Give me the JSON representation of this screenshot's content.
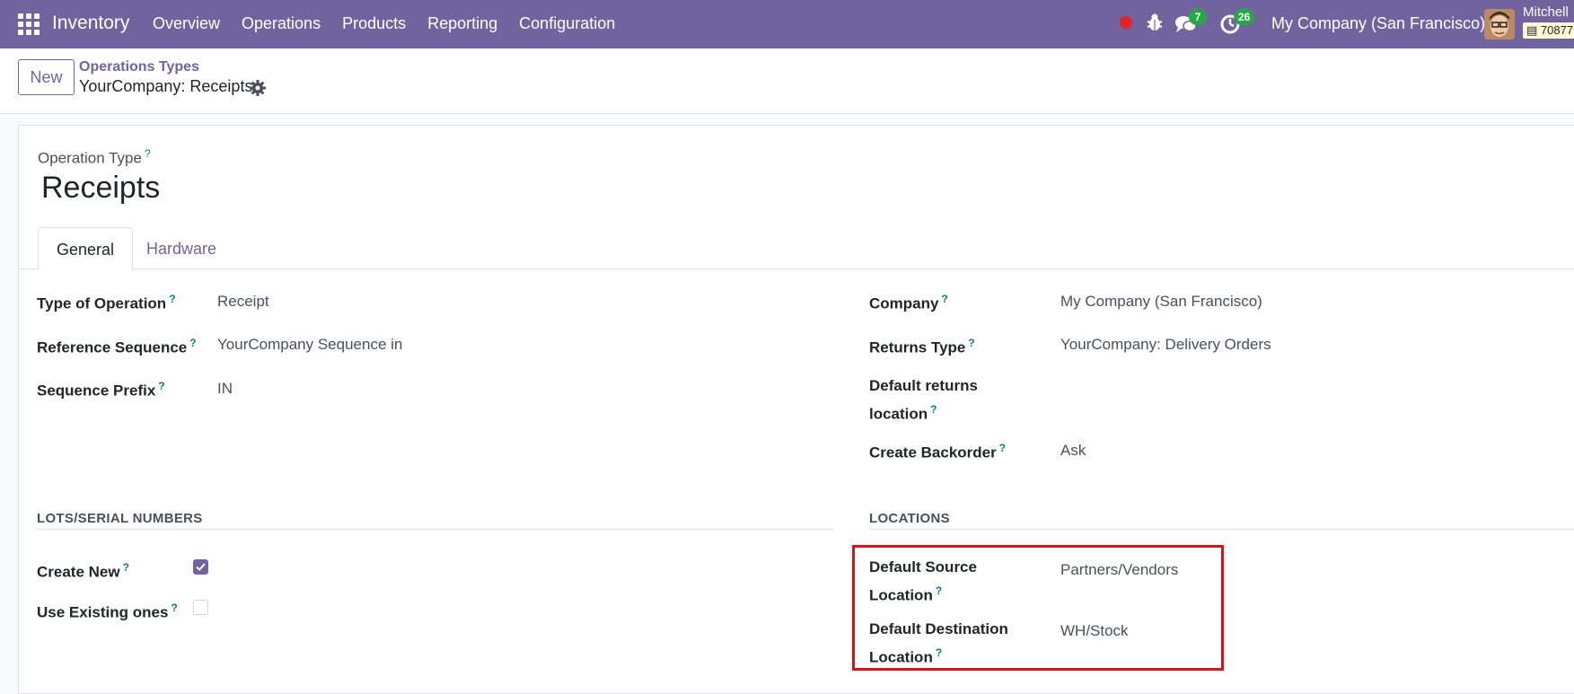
{
  "navbar": {
    "app_name": "Inventory",
    "menu": [
      "Overview",
      "Operations",
      "Products",
      "Reporting",
      "Configuration"
    ],
    "chat_count": "7",
    "activity_count": "26",
    "company": "My Company (San Francisco)",
    "user_name": "Mitchell",
    "db_label": "70877",
    "colors": {
      "brand": "#71639e",
      "badge": "#28a745",
      "record_dot": "#e0242c"
    }
  },
  "control_panel": {
    "new_label": "New",
    "breadcrumb_parent": "Operations Types",
    "breadcrumb_current": "YourCompany: Receipts"
  },
  "form": {
    "operation_type_label": "Operation Type",
    "help_mark": "?",
    "title": "Receipts",
    "tabs": [
      "General",
      "Hardware"
    ],
    "left_fields": [
      {
        "label": "Type of Operation",
        "value": "Receipt"
      },
      {
        "label": "Reference Sequence",
        "value": "YourCompany Sequence in"
      },
      {
        "label": "Sequence Prefix",
        "value": "IN"
      }
    ],
    "right_fields": [
      {
        "label": "Company",
        "value": "My Company (San Francisco)"
      },
      {
        "label": "Returns Type",
        "value": "YourCompany: Delivery Orders"
      },
      {
        "label_line1": "Default returns",
        "label_line2": "location",
        "value": ""
      },
      {
        "label": "Create Backorder",
        "value": "Ask"
      }
    ],
    "lots_section": {
      "title": "LOTS/SERIAL NUMBERS",
      "fields": [
        {
          "label": "Create New",
          "checked": true
        },
        {
          "label": "Use Existing ones",
          "checked": false
        }
      ]
    },
    "locations_section": {
      "title": "LOCATIONS",
      "fields": [
        {
          "label_line1": "Default Source",
          "label_line2": "Location",
          "value": "Partners/Vendors"
        },
        {
          "label_line1": "Default Destination",
          "label_line2": "Location",
          "value": "WH/Stock"
        }
      ]
    }
  }
}
